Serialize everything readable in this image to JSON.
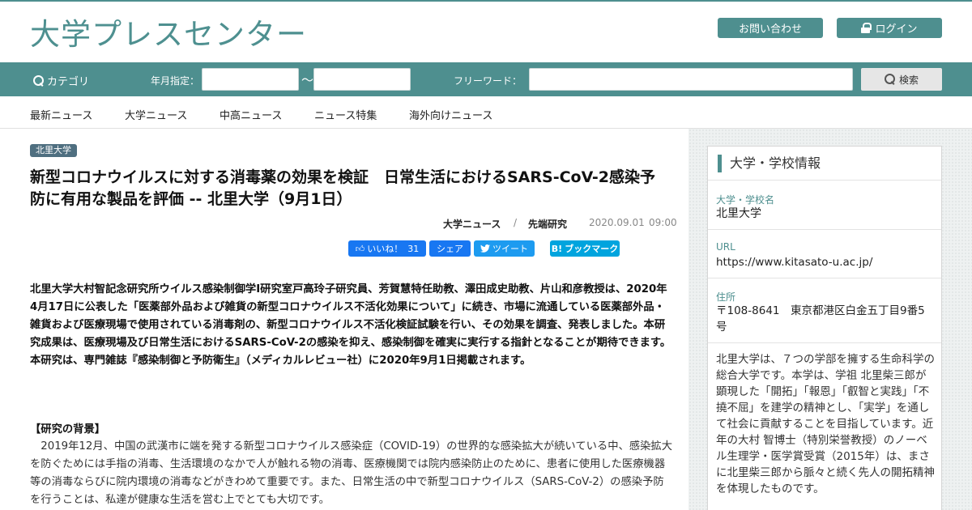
{
  "header": {
    "logo": "大学プレスセンター",
    "contact_label": "お問い合わせ",
    "login_label": "ログイン"
  },
  "searchbar": {
    "category_label": "カテゴリ",
    "date_label": "年月指定：",
    "date_from_value": "",
    "tilde": "〜",
    "date_to_value": "",
    "freeword_label": "フリーワード：",
    "freeword_value": "",
    "search_button": "検索"
  },
  "nav": {
    "items": [
      "最新ニュース",
      "大学ニュース",
      "中高ニュース",
      "ニュース特集",
      "海外向けニュース"
    ]
  },
  "article": {
    "badge": "北里大学",
    "title": "新型コロナウイルスに対する消毒薬の効果を検証　日常生活におけるSARS-CoV-2感染予防に有用な製品を評価 -- 北里大学（9月1日）",
    "category1": "大学ニュース",
    "separator": "/",
    "category2": "先端研究",
    "date": "2020.09.01",
    "time": "09:00",
    "share": {
      "like_label": "いいね！",
      "like_count": "31",
      "share_label": "シェア",
      "tweet_label": "ツイート",
      "hatena_icon_text": "B!",
      "hatena_label": "ブックマーク"
    },
    "lead": "北里大学大村智記念研究所ウイルス感染制御学Ⅰ研究室戸高玲子研究員、芳賀慧特任助教、澤田成史助教、片山和彦教授は、2020年4月17日に公表した「医薬部外品および雑貨の新型コロナウイルス不活化効果について」に続き、市場に流通している医薬部外品・雑貨および医療現場で使用されている消毒剤の、新型コロナウイルス不活化検証試験を行い、その効果を調査、発表しました。本研究成果は、医療現場及び日常生活におけるSARS-CoV-2の感染を抑え、感染制御を確実に実行する指針となることが期待できます。本研究は、専門雑誌『感染制御と予防衛生』（メディカルレビュー社）に2020年9月1日掲載されます。",
    "section_title": "【研究の背景】",
    "body": "　2019年12月、中国の武漢市に端を発する新型コロナウイルス感染症（COVID-19）の世界的な感染拡大が続いている中、感染拡大を防ぐためには手指の消毒、生活環境のなかで人が触れる物の消毒、医療機関では院内感染防止のために、患者に使用した医療機器等の消毒ならびに院内環境の消毒などがきわめて重要です。また、日常生活の中で新型コロナウイルス（SARS-CoV-2）の感染予防を行うことは、私達が健康な生活を営む上でとても大切です。"
  },
  "sidebar": {
    "heading": "大学・学校情報",
    "name_key": "大学・学校名",
    "name_value": "北里大学",
    "url_key": "URL",
    "url_value": "https://www.kitasato-u.ac.jp/",
    "address_key": "住所",
    "address_value": "〒108-8641　東京都港区白金五丁目9番5号",
    "description": "北里大学は、７つの学部を擁する生命科学の総合大学です。本学は、学祖 北里柴三郎が顕現した「開拓」「報恩」「叡智と実践」「不撓不屈」を建学の精神とし、「実学」を通して社会に貢献することを目指しています。近年の大村 智博士（特別栄誉教授）のノーベル生理学・医学賞受賞（2015年）は、まさに北里柴三郎から脈々と続く先人の開拓精神を体現したものです。"
  },
  "colors": {
    "brand": "#4e8f8f",
    "badge": "#4f6f80",
    "facebook": "#1877f2",
    "twitter": "#1d9bf0",
    "hatena": "#00a4de"
  }
}
